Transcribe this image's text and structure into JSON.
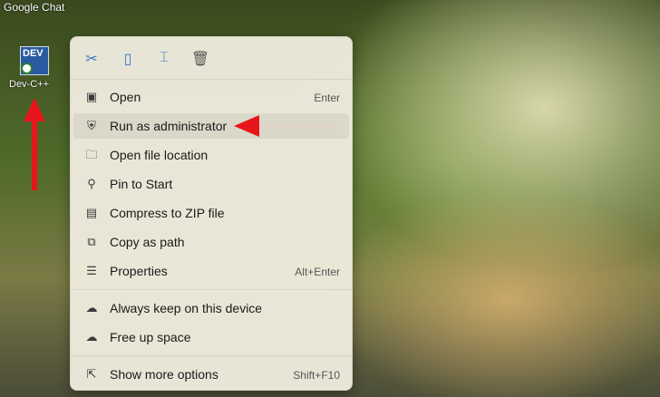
{
  "desktop": {
    "window_title": "Google Chat",
    "app_icon_label": "Dev-C++",
    "app_icon_text": "DEV"
  },
  "toolbar": [
    {
      "name": "cut",
      "icon": "✂"
    },
    {
      "name": "copy",
      "icon": "▯"
    },
    {
      "name": "rename",
      "icon": "⌶"
    },
    {
      "name": "delete",
      "icon": "🗑"
    }
  ],
  "menu": [
    {
      "label": "Open",
      "shortcut": "Enter",
      "icon": "▣"
    },
    {
      "label": "Run as administrator",
      "shortcut": "",
      "icon": "⛨"
    },
    {
      "label": "Open file location",
      "shortcut": "",
      "icon": "🗀"
    },
    {
      "label": "Pin to Start",
      "shortcut": "",
      "icon": "⚲"
    },
    {
      "label": "Compress to ZIP file",
      "shortcut": "",
      "icon": "▤"
    },
    {
      "label": "Copy as path",
      "shortcut": "",
      "icon": "⧉"
    },
    {
      "label": "Properties",
      "shortcut": "Alt+Enter",
      "icon": "☰"
    },
    {
      "label": "Always keep on this device",
      "shortcut": "",
      "icon": "☁"
    },
    {
      "label": "Free up space",
      "shortcut": "",
      "icon": "☁"
    },
    {
      "label": "Show more options",
      "shortcut": "Shift+F10",
      "icon": "⇱"
    }
  ],
  "accent": "#3a78c4",
  "annotation_color": "#e8161a"
}
